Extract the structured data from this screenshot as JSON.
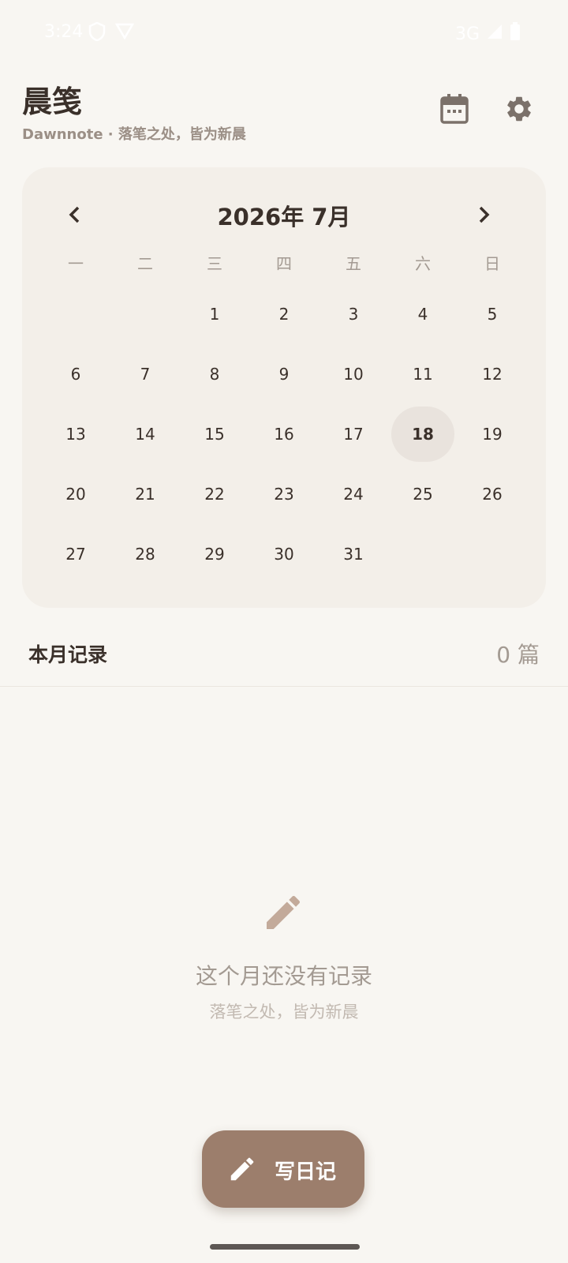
{
  "status_bar": {
    "time": "3:24",
    "network": "3G"
  },
  "header": {
    "title": "晨笺",
    "subtitle": "Dawnnote · 落笔之处，皆为新晨"
  },
  "calendar": {
    "month_title": "2026年 7月",
    "weekdays": [
      "一",
      "二",
      "三",
      "四",
      "五",
      "六",
      "日"
    ],
    "weeks": [
      [
        "",
        "",
        "1",
        "2",
        "3",
        "4",
        "5"
      ],
      [
        "6",
        "7",
        "8",
        "9",
        "10",
        "11",
        "12"
      ],
      [
        "13",
        "14",
        "15",
        "16",
        "17",
        "18",
        "19"
      ],
      [
        "20",
        "21",
        "22",
        "23",
        "24",
        "25",
        "26"
      ],
      [
        "27",
        "28",
        "29",
        "30",
        "31",
        "",
        ""
      ]
    ],
    "today": "18"
  },
  "records": {
    "label": "本月记录",
    "count": "0 篇"
  },
  "empty_state": {
    "icon": "pencil-icon",
    "title": "这个月还没有记录",
    "subtitle": "落笔之处，皆为新晨"
  },
  "fab": {
    "label": "写日记",
    "icon": "pencil-icon"
  },
  "colors": {
    "background": "#f8f6f2",
    "card": "#f3efe9",
    "accent": "#9c7e6c",
    "today_highlight": "#e9e3dd"
  }
}
